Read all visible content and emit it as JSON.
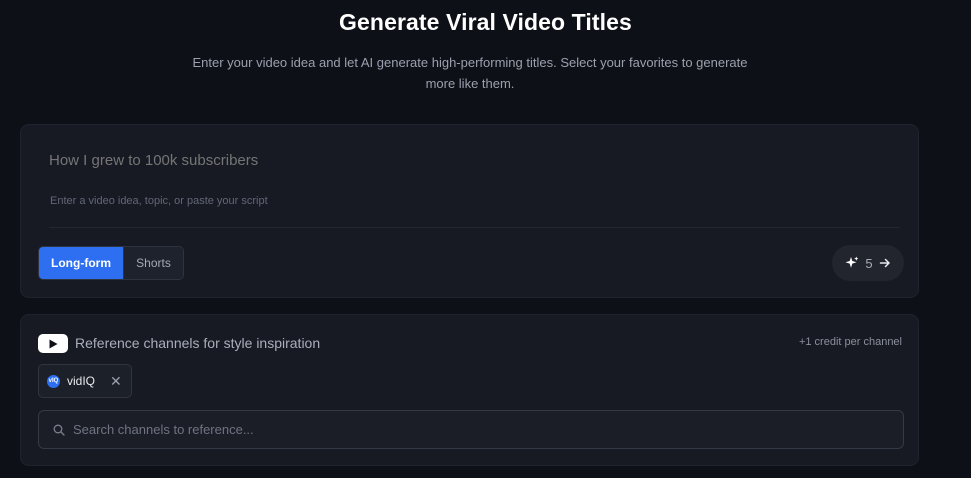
{
  "header": {
    "title": "Generate Viral Video Titles",
    "subtitle": "Enter your video idea and let AI generate high-performing titles. Select your favorites to generate more like them."
  },
  "idea_card": {
    "input_placeholder": "How I grew to 100k subscribers",
    "input_value": "",
    "hint": "Enter a video idea, topic, or paste your script",
    "format_options": [
      {
        "label": "Long-form",
        "selected": true
      },
      {
        "label": "Shorts",
        "selected": false
      }
    ],
    "generate_button": {
      "icon": "sparkle-icon",
      "count": "5",
      "arrow_icon": "arrow-right-icon"
    }
  },
  "reference_card": {
    "icon": "youtube-icon",
    "label": "Reference channels for style inspiration",
    "credit_note": "+1 credit per channel",
    "selected_channels": [
      {
        "name": "vidIQ",
        "avatar_text": "vIQ",
        "remove_icon": "close-icon"
      }
    ],
    "search_placeholder": "Search channels to reference..."
  },
  "colors": {
    "background": "#0e1017",
    "card": "#171a23",
    "accent": "#2d6ff0"
  }
}
